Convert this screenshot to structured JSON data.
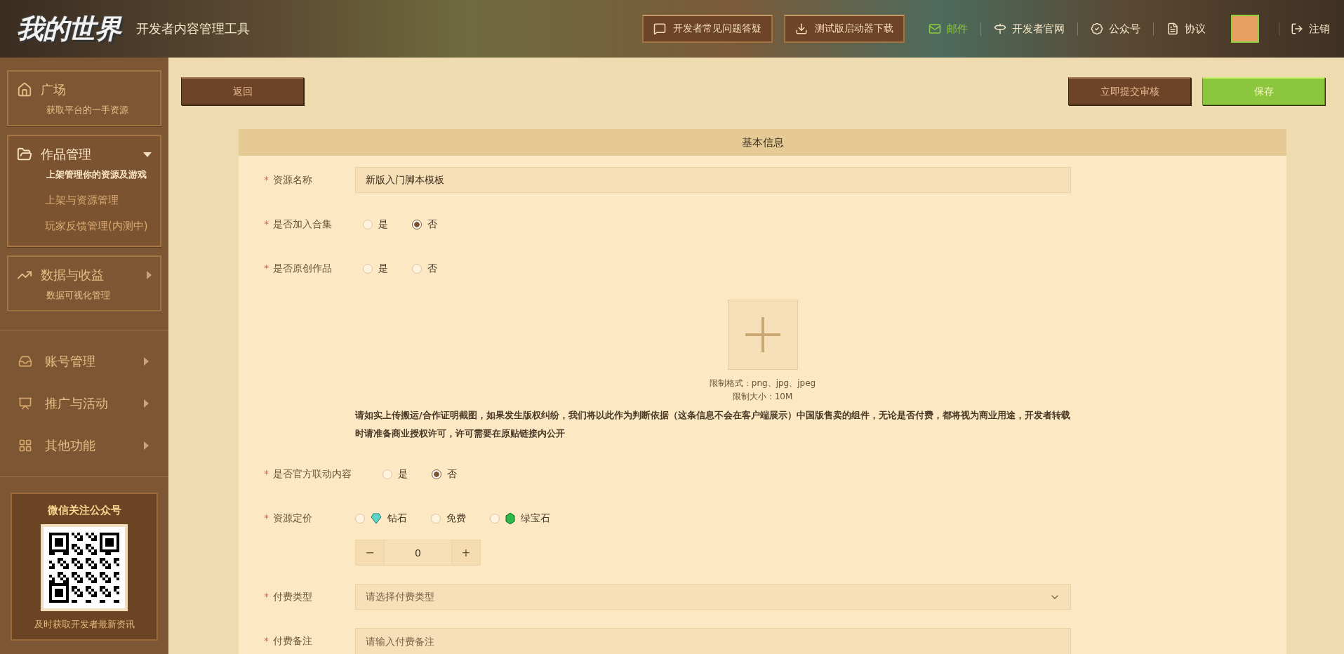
{
  "header": {
    "logo": "我的世界",
    "title": "开发者内容管理工具",
    "buttons": [
      "开发者常见问题答疑",
      "测试版启动器下载"
    ],
    "links": [
      {
        "label": "邮件",
        "selected": true
      },
      {
        "label": "开发者官网",
        "selected": false
      },
      {
        "label": "公众号",
        "selected": false
      },
      {
        "label": "协议",
        "selected": false
      }
    ],
    "logout": "注销"
  },
  "sidebar": {
    "cards": [
      {
        "title": "广场",
        "subtitle": "获取平台的一手资源",
        "selected": false
      },
      {
        "title": "作品管理",
        "subtitle": "上架管理你的资源及游戏",
        "selected": true,
        "expanded": true,
        "children": [
          "上架与资源管理",
          "玩家反馈管理(内测中)"
        ]
      },
      {
        "title": "数据与收益",
        "subtitle": "数据可视化管理",
        "selected": false,
        "expanded": false
      }
    ],
    "items": [
      {
        "label": "账号管理",
        "expanded": false
      },
      {
        "label": "推广与活动",
        "expanded": false
      },
      {
        "label": "其他功能",
        "expanded": false
      }
    ],
    "qr": {
      "title": "微信关注公众号",
      "caption": "及时获取开发者最新资讯"
    }
  },
  "toolbar": {
    "back": "返回",
    "submit": "立即提交审核",
    "save": "保存"
  },
  "form": {
    "title": "基本信息",
    "fields": [
      {
        "kind": "text",
        "mark": "*",
        "label": "资源名称",
        "value": "新版入门脚本模板"
      },
      {
        "kind": "radio",
        "mark": "*",
        "label": "是否加入合集",
        "options": [
          {
            "label": "是",
            "selected": false
          },
          {
            "label": "否",
            "selected": true
          }
        ]
      },
      {
        "kind": "radio",
        "mark": "*",
        "label": "是否原创作品",
        "options": [
          {
            "label": "是",
            "selected": false
          },
          {
            "label": "否",
            "selected": false
          }
        ]
      },
      {
        "kind": "upload",
        "hints": [
          "限制格式：png、jpg、jpeg",
          "限制大小：10M"
        ],
        "notice": "请如实上传搬运/合作证明截图，如果发生版权纠纷，我们将以此作为判断依据（这条信息不会在客户端展示）中国版售卖的组件，无论是否付费，都将视为商业用途，开发者转载时请准备商业授权许可，许可需要在原贴链接内公开"
      },
      {
        "kind": "radio",
        "mark": "*",
        "label": "是否官方联动内容",
        "options": [
          {
            "label": "是",
            "selected": false
          },
          {
            "label": "否",
            "selected": true
          }
        ]
      },
      {
        "kind": "price",
        "mark": "*",
        "label": "资源定价",
        "options": [
          {
            "kind": "diamond",
            "label": "钻石",
            "selected": false
          },
          {
            "kind": "plain",
            "label": "免费",
            "selected": false
          },
          {
            "kind": "emerald",
            "label": "绿宝石",
            "selected": false
          }
        ],
        "stepper": {
          "minus": "−",
          "value": "0",
          "plus": "+"
        }
      },
      {
        "kind": "select",
        "mark": "*",
        "label": "付费类型",
        "placeholder": "请选择付费类型"
      },
      {
        "kind": "textarea",
        "mark": "*",
        "label": "付费备注",
        "placeholder": "请输入付费备注"
      }
    ]
  }
}
